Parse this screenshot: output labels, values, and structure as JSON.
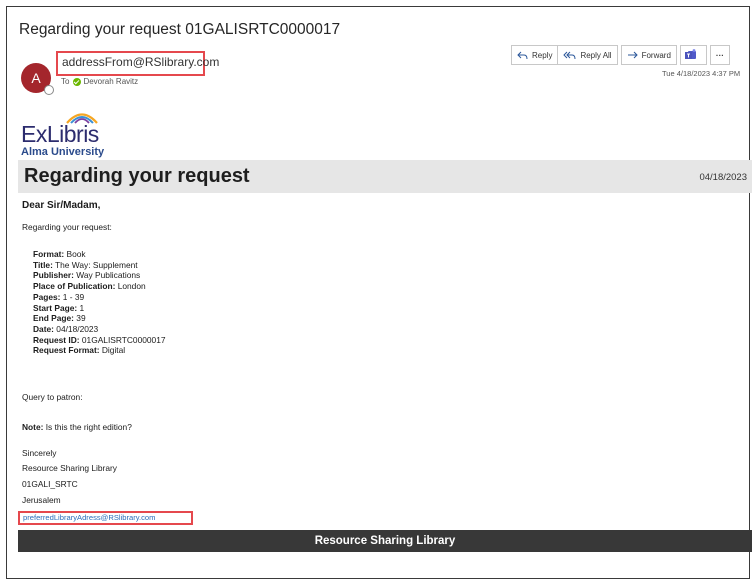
{
  "email": {
    "subject": "Regarding your request 01GALISRTC0000017",
    "avatar_initial": "A",
    "from": "addressFrom@RSlibrary.com",
    "to_label": "To",
    "to_name": "Devorah Ravitz",
    "timestamp": "Tue 4/18/2023 4:37 PM"
  },
  "toolbar": {
    "reply": "Reply",
    "reply_all": "Reply All",
    "forward": "Forward",
    "more": "···"
  },
  "letter": {
    "logo_text": "ExLibris",
    "logo_sub": "Alma University",
    "heading": "Regarding your request",
    "date": "04/18/2023",
    "salutation": "Dear Sir/Madam,",
    "intro": "Regarding your request:",
    "details": [
      {
        "label": "Format:",
        "value": " Book"
      },
      {
        "label": "Title:",
        "value": " The Way: Supplement"
      },
      {
        "label": "Publisher:",
        "value": " Way Publications"
      },
      {
        "label": "Place of Publication:",
        "value": " London"
      },
      {
        "label": "Pages:",
        "value": " 1 - 39"
      },
      {
        "label": "Start Page:",
        "value": " 1"
      },
      {
        "label": "End Page:",
        "value": " 39"
      },
      {
        "label": "Date:",
        "value": " 04/18/2023"
      },
      {
        "label": "Request ID:",
        "value": " 01GALISRTC0000017"
      },
      {
        "label": "Request Format:",
        "value": " Digital"
      }
    ],
    "query": "Query to patron:",
    "note_label": "Note:",
    "note_value": " Is this the right edition?",
    "sign_off": "Sincerely",
    "library_name": "Resource Sharing Library",
    "library_code": "01GALI_SRTC",
    "city": "Jerusalem",
    "email_link": "preferredLibraryAdress@RSlibrary.com",
    "footer": "Resource Sharing Library"
  },
  "colors": {
    "highlight_border": "#e5484d",
    "avatar_bg": "#a4262c",
    "footer_bg": "#383838",
    "banner_bg": "#e6e6e6",
    "link": "#2a6ebb"
  }
}
